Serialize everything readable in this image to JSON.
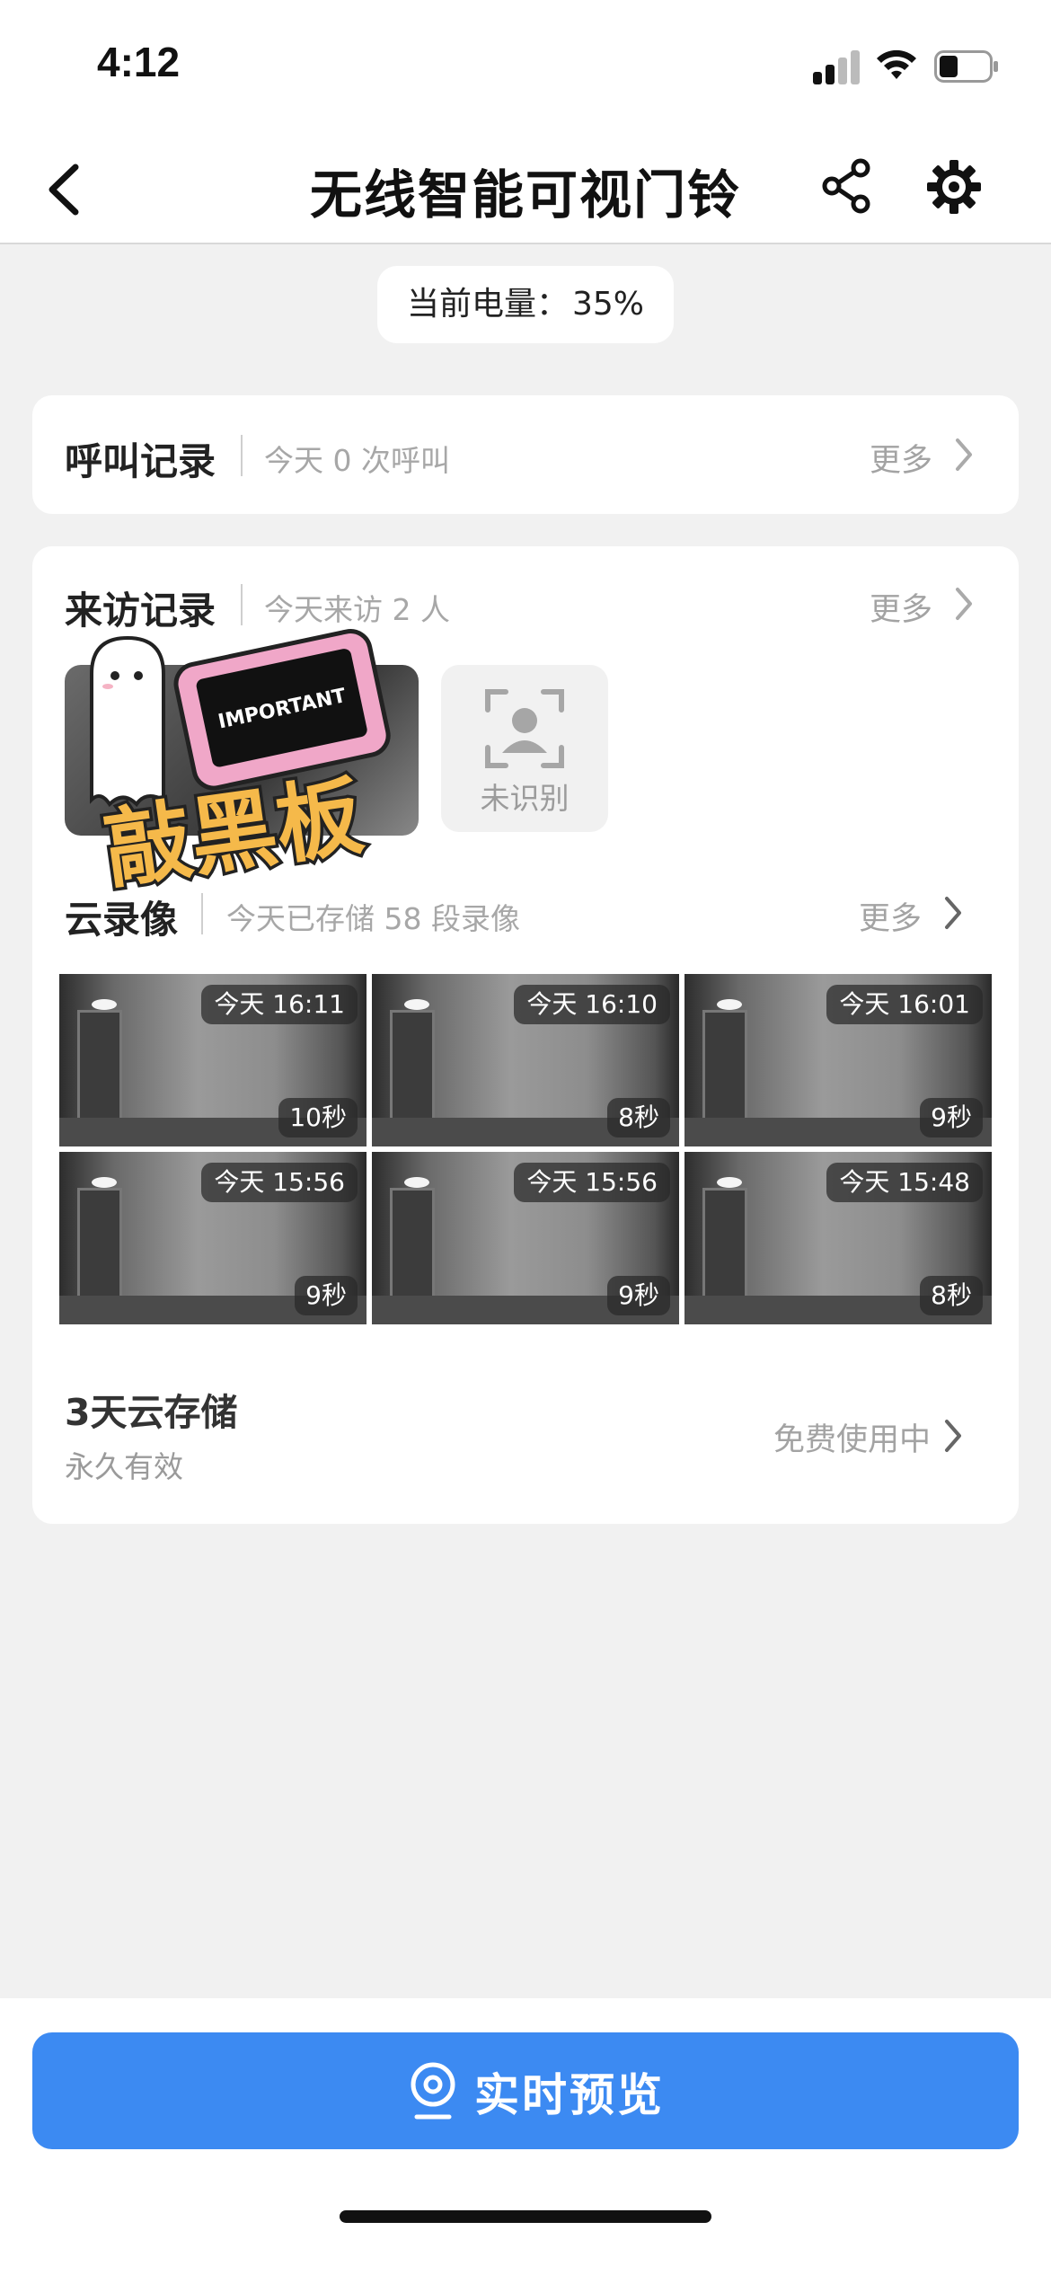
{
  "status_bar": {
    "time": "4:12"
  },
  "nav": {
    "title": "无线智能可视门铃"
  },
  "battery": {
    "label": "当前电量：",
    "value": "35%"
  },
  "call_record": {
    "title": "呼叫记录",
    "summary": "今天 0 次呼叫",
    "more": "更多"
  },
  "visit_record": {
    "title": "来访记录",
    "summary": "今天来访 2 人",
    "more": "更多",
    "unrecognized_label": "未识别"
  },
  "sticker": {
    "top_text": "IMPORTANT",
    "main_text": "敲黑板"
  },
  "cloud_video": {
    "title": "云录像",
    "summary": "今天已存储 58 段录像",
    "more": "更多",
    "clips": [
      {
        "time": "今天 16:11",
        "duration": "10秒"
      },
      {
        "time": "今天 16:10",
        "duration": "8秒"
      },
      {
        "time": "今天 16:01",
        "duration": "9秒"
      },
      {
        "time": "今天 15:56",
        "duration": "9秒"
      },
      {
        "time": "今天 15:56",
        "duration": "9秒"
      },
      {
        "time": "今天 15:48",
        "duration": "8秒"
      }
    ]
  },
  "cloud_storage": {
    "title": "3天云存储",
    "validity": "永久有效",
    "status": "免费使用中"
  },
  "live_preview": {
    "label": "实时预览"
  },
  "colors": {
    "accent": "#3c8af2",
    "background": "#f1f1f1"
  }
}
